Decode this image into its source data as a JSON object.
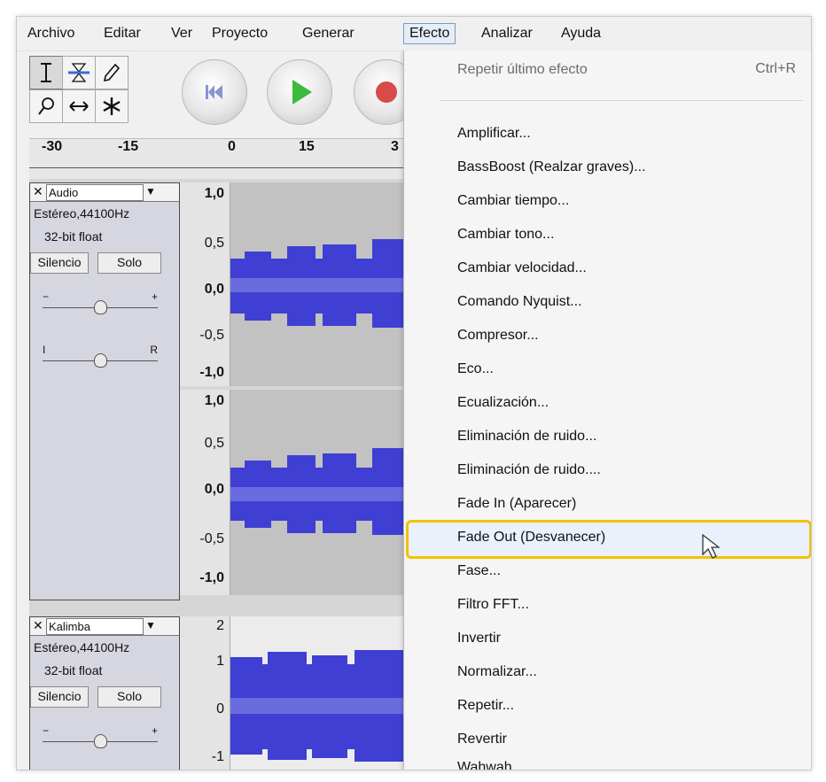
{
  "menubar": {
    "items": [
      "Archivo",
      "Editar",
      "Ver",
      "Proyecto",
      "Generar",
      "Efecto",
      "Analizar",
      "Ayuda"
    ],
    "active": "Efecto"
  },
  "tools": {
    "row1": [
      "selection-tool",
      "envelope-tool",
      "draw-tool"
    ],
    "row2": [
      "zoom-tool",
      "time-shift-tool",
      "multi-tool"
    ]
  },
  "transport": {
    "buttons": [
      "skip-to-start",
      "play",
      "record"
    ]
  },
  "timeline": {
    "ticks": [
      "-30",
      "-15",
      "0",
      "15",
      "3"
    ]
  },
  "tracks": [
    {
      "name": "Audio",
      "info1": "Estéreo,44100Hz",
      "info2": "32-bit float",
      "mute": "Silencio",
      "solo": "Solo",
      "gain_left": "−",
      "gain_right": "+",
      "pan_left": "I",
      "pan_right": "R",
      "scale_top": [
        "1,0",
        "0,5",
        "0,0",
        "-0,5",
        "-1,0"
      ],
      "scale_bottom": [
        "1,0",
        "0,5",
        "0,0",
        "-0,5",
        "-1,0"
      ]
    },
    {
      "name": "Kalimba",
      "info1": "Estéreo,44100Hz",
      "info2": "32-bit float",
      "mute": "Silencio",
      "solo": "Solo",
      "gain_left": "−",
      "gain_right": "+",
      "pan_left": "I",
      "pan_right": "R",
      "scale": [
        "2",
        "1",
        "0",
        "-1"
      ]
    }
  ],
  "effect_menu": {
    "repeat_last": "Repetir último efecto",
    "repeat_shortcut": "Ctrl+R",
    "items": [
      "Amplificar...",
      "BassBoost (Realzar graves)...",
      "Cambiar tiempo...",
      "Cambiar tono...",
      "Cambiar velocidad...",
      "Comando Nyquist...",
      "Compresor...",
      "Eco...",
      "Ecualización...",
      "Eliminación de ruido...",
      "Eliminación de ruido....",
      "Fade In (Aparecer)",
      "Fade Out (Desvanecer)",
      "Fase...",
      "Filtro FFT...",
      "Invertir",
      "Normalizar...",
      "Repetir...",
      "Revertir",
      "Wahwah..."
    ],
    "highlighted": "Fade Out (Desvanecer)"
  },
  "colors": {
    "waveform": "#3f3fd3",
    "waveform_light": "#6b6be0",
    "highlight_border": "#f2c200"
  }
}
